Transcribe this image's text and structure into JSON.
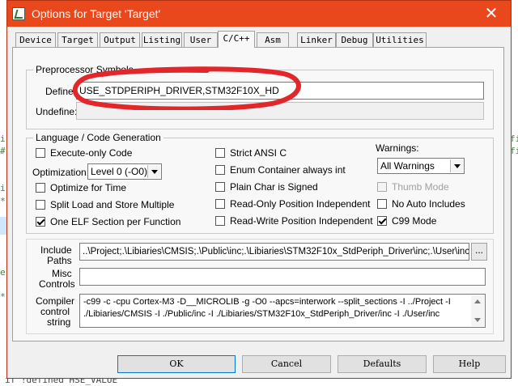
{
  "window": {
    "title": "Options for Target 'Target'",
    "close_glyph": "✕",
    "accent_color": "#e8481c"
  },
  "tabs": [
    {
      "label": "Device"
    },
    {
      "label": "Target"
    },
    {
      "label": "Output"
    },
    {
      "label": "Listing"
    },
    {
      "label": "User"
    },
    {
      "label": "C/C++",
      "active": true
    },
    {
      "label": "Asm"
    },
    {
      "label": "Linker"
    },
    {
      "label": "Debug"
    },
    {
      "label": "Utilities"
    }
  ],
  "preprocessor": {
    "legend": "Preprocessor Symbols",
    "define_label": "Define:",
    "define_value": "USE_STDPERIPH_DRIVER,STM32F10X_HD",
    "undefine_label": "Undefine:",
    "undefine_value": ""
  },
  "language": {
    "legend": "Language / Code Generation",
    "execute_only": {
      "label": "Execute-only Code",
      "checked": false
    },
    "optimization_label": "Optimization:",
    "optimization_value": "Level 0 (-O0)",
    "optimize_time": {
      "label": "Optimize for Time",
      "checked": false
    },
    "split_load": {
      "label": "Split Load and Store Multiple",
      "checked": false
    },
    "one_elf": {
      "label": "One ELF Section per Function",
      "checked": true
    },
    "strict_ansi": {
      "label": "Strict ANSI C",
      "checked": false
    },
    "enum_container": {
      "label": "Enum Container always int",
      "checked": false
    },
    "plain_char": {
      "label": "Plain Char is Signed",
      "checked": false
    },
    "ro_pi": {
      "label": "Read-Only Position Independent",
      "checked": false
    },
    "rw_pi": {
      "label": "Read-Write Position Independent",
      "checked": false
    },
    "warnings_label": "Warnings:",
    "warnings_value": "All Warnings",
    "thumb_mode": {
      "label": "Thumb Mode",
      "checked": false,
      "disabled": true
    },
    "no_auto_includes": {
      "label": "No Auto Includes",
      "checked": false
    },
    "c99_mode": {
      "label": "C99 Mode",
      "checked": true
    }
  },
  "paths": {
    "include_label_1": "Include",
    "include_label_2": "Paths",
    "include_value": "..\\Project;.\\Libiaries\\CMSIS;.\\Public\\inc;.\\Libiaries\\STM32F10x_StdPeriph_Driver\\inc;.\\User\\inc",
    "browse_label": "...",
    "misc_label_1": "Misc",
    "misc_label_2": "Controls",
    "misc_value": "",
    "compiler_label_1": "Compiler",
    "compiler_label_2": "control",
    "compiler_label_3": "string",
    "compiler_line_1": "-c99 -c -cpu Cortex-M3 -D__MICROLIB -g -O0 --apcs=interwork --split_sections -I ../Project -I",
    "compiler_line_2": "./Libiaries/CMSIS -I ./Public/inc -I ./Libiaries/STM32F10x_StdPeriph_Driver/inc -I ./User/inc"
  },
  "buttons": {
    "ok": "OK",
    "cancel": "Cancel",
    "defaults": "Defaults",
    "help": "Help"
  },
  "background": {
    "left_fragments": [
      "i",
      "#",
      "i",
      "*",
      "e",
      "*"
    ],
    "right_fragments": [
      "fi",
      "fi"
    ],
    "bottom_text": "if  !defined   HSE_VALUE"
  }
}
